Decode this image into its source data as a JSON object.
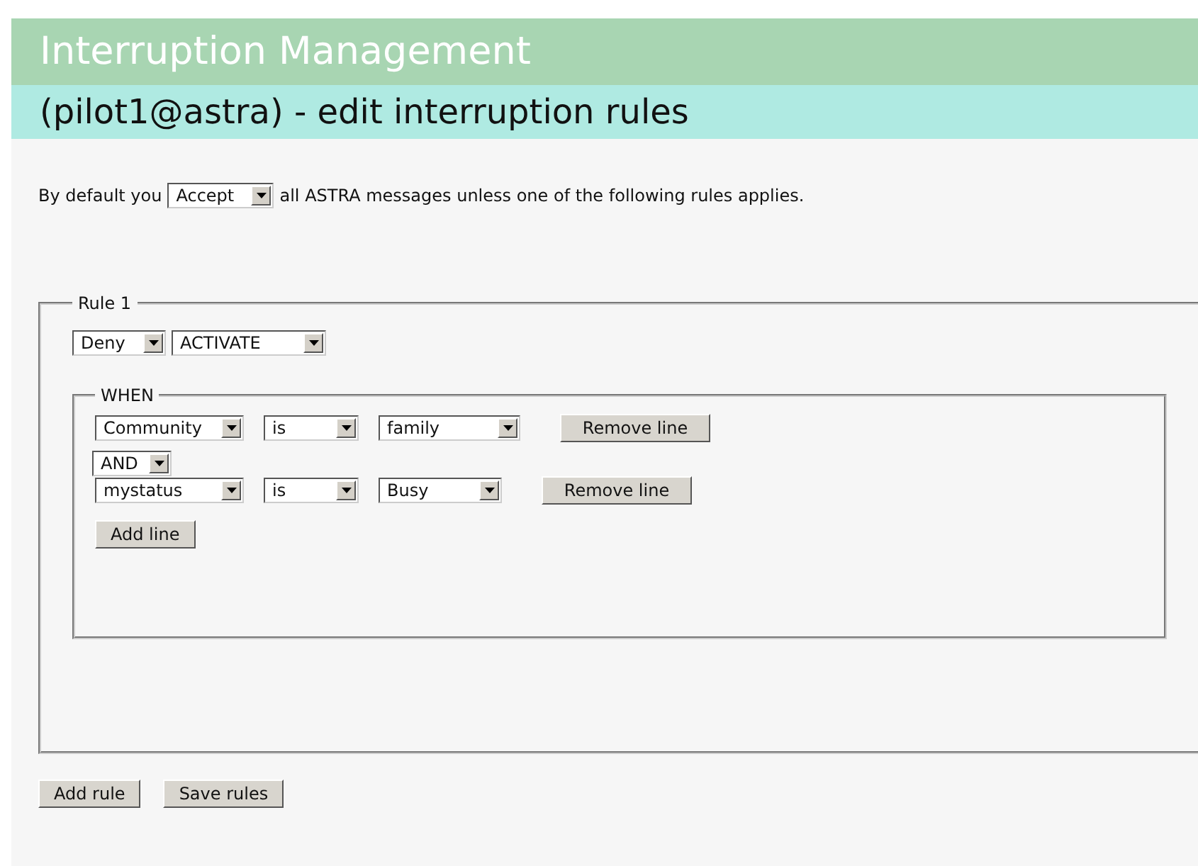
{
  "header": {
    "title": "Interruption Management"
  },
  "subheader": {
    "title": "(pilot1@astra) - edit interruption rules"
  },
  "default": {
    "prefix": "By default you",
    "value": "Accept",
    "suffix": "all ASTRA messages unless one of the following rules applies."
  },
  "rules": [
    {
      "legend": "Rule 1",
      "action": "Deny",
      "event": "ACTIVATE",
      "when": {
        "legend": "WHEN",
        "conditions": [
          {
            "field": "Community",
            "operator": "is",
            "value": "family",
            "remove": "Remove line"
          },
          {
            "connector": "AND",
            "field": "mystatus",
            "operator": "is",
            "value": "Busy",
            "remove": "Remove line"
          }
        ],
        "add": "Add line"
      }
    }
  ],
  "buttons": [
    "Add rule",
    "Save rules"
  ]
}
